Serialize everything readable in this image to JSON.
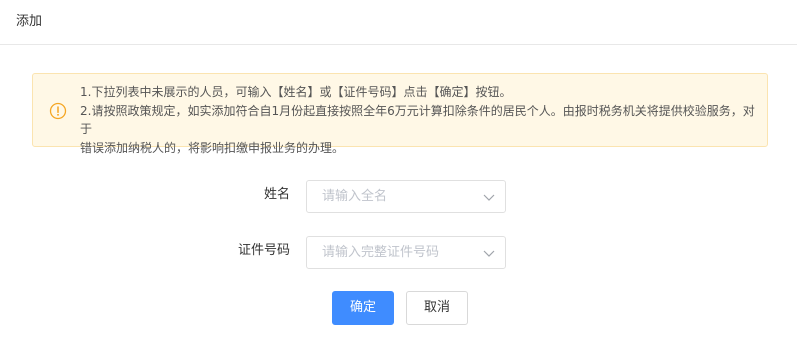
{
  "dialog": {
    "title": "添加"
  },
  "notice": {
    "icon": "warning-circle-icon",
    "color": "#f5a623",
    "line1": "1.下拉列表中未展示的人员，可输入【姓名】或【证件号码】点击【确定】按钮。",
    "line2": "2.请按照政策规定，如实添加符合自1月份起直接按照全年6万元计算扣除条件的居民个人。由报时税务机关将提供校验服务，对于",
    "line3": "错误添加纳税人的，将影响扣缴申报业务的办理。"
  },
  "form": {
    "name": {
      "label": "姓名",
      "placeholder": "请输入全名"
    },
    "id_number": {
      "label": "证件号码",
      "placeholder": "请输入完整证件号码"
    }
  },
  "buttons": {
    "confirm": "确定",
    "cancel": "取消"
  },
  "colors": {
    "primary": "#3f8cff",
    "notice_bg": "#fff8e6"
  }
}
